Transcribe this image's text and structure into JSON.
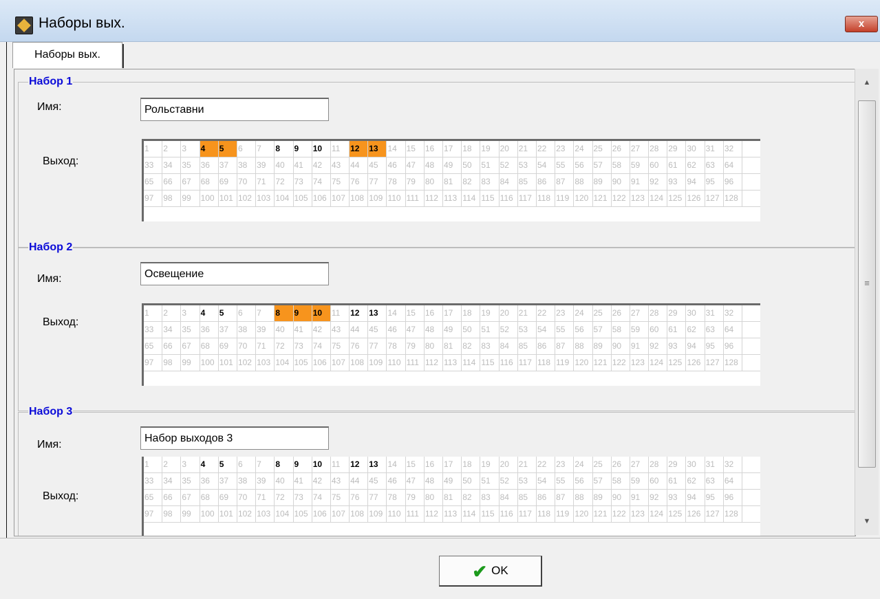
{
  "window": {
    "title": "Наборы вых.",
    "close_label": "x"
  },
  "tabs": [
    {
      "label": "Наборы вых."
    }
  ],
  "labels": {
    "name": "Имя:",
    "output": "Выход:"
  },
  "outputs_max": 128,
  "groups": [
    {
      "title": "Набор 1",
      "name": "Рольставни",
      "active_outputs": [
        4,
        5,
        8,
        9,
        10,
        12,
        13
      ],
      "selected_outputs": [
        4,
        5,
        12,
        13
      ]
    },
    {
      "title": "Набор 2",
      "name": "Освещение",
      "active_outputs": [
        4,
        5,
        8,
        9,
        10,
        12,
        13
      ],
      "selected_outputs": [
        8,
        9,
        10
      ]
    },
    {
      "title": "Набор 3",
      "name": "Набор выходов 3",
      "active_outputs": [
        4,
        5,
        8,
        9,
        10,
        12,
        13
      ],
      "selected_outputs": []
    }
  ],
  "footer": {
    "ok_label": "OK"
  },
  "colors": {
    "selected": "#f7941d",
    "group_title": "#0a0ad8",
    "inactive_text": "#bcbcbc"
  },
  "icons": {
    "app": "app-icon",
    "close": "close-icon",
    "ok": "check-icon",
    "scroll_up": "triangle-up",
    "scroll_down": "triangle-down"
  }
}
